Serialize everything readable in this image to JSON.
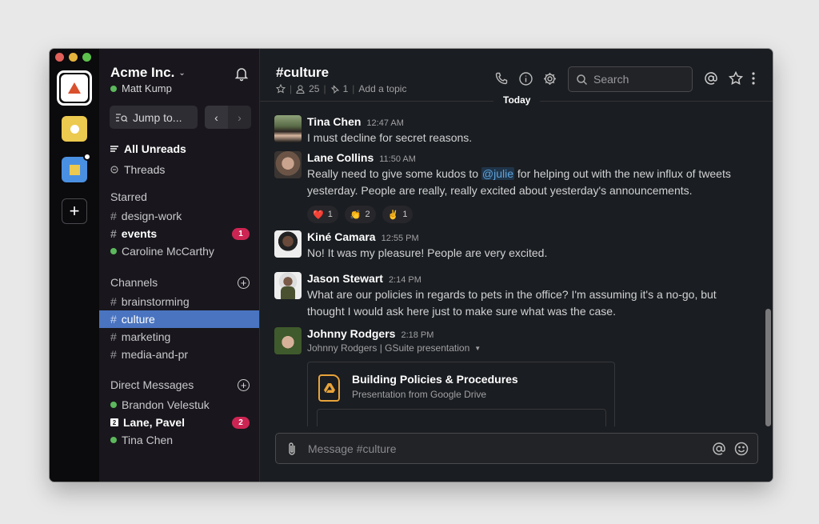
{
  "window": {
    "traffic_lights": {
      "close": "#e0605a",
      "minimize": "#e5b43c",
      "maximize": "#5cc24c"
    }
  },
  "rail": {
    "workspaces": [
      {
        "name": "Acme Inc.",
        "color": "#ffffff",
        "accent": "#d9502d",
        "active": true
      },
      {
        "name": "Yellow workspace",
        "color": "#ecc94f"
      },
      {
        "name": "Blue workspace",
        "color": "#4a90e2",
        "has_notification": true
      }
    ],
    "add_label": "+"
  },
  "sidebar": {
    "team_name": "Acme Inc.",
    "user_name": "Matt Kump",
    "jump_to": "Jump to...",
    "nav": [
      {
        "label": "All Unreads",
        "icon": "list-icon",
        "bold": true
      },
      {
        "label": "Threads",
        "icon": "threads-icon"
      }
    ],
    "starred": {
      "title": "Starred",
      "items": [
        {
          "label": "design-work",
          "type": "channel"
        },
        {
          "label": "events",
          "type": "channel",
          "bold": true,
          "badge": "1"
        },
        {
          "label": "Caroline McCarthy",
          "type": "dm",
          "online": true
        }
      ]
    },
    "channels": {
      "title": "Channels",
      "items": [
        {
          "label": "brainstorming"
        },
        {
          "label": "culture",
          "active": true
        },
        {
          "label": "marketing"
        },
        {
          "label": "media-and-pr"
        }
      ]
    },
    "direct_messages": {
      "title": "Direct Messages",
      "items": [
        {
          "label": "Brandon Velestuk",
          "online": true
        },
        {
          "label": "Lane, Pavel",
          "bold": true,
          "group_count": "2",
          "badge": "2"
        },
        {
          "label": "Tina Chen",
          "online": true
        }
      ]
    }
  },
  "header": {
    "channel": "#culture",
    "members": "25",
    "pinned": "1",
    "topic": "Add a topic",
    "separator": "|",
    "search_placeholder": "Search",
    "date_divider": "Today"
  },
  "messages": [
    {
      "author": "Tina Chen",
      "time": "12:47 AM",
      "text": "I must decline for secret reasons."
    },
    {
      "author": "Lane Collins",
      "time": "11:50 AM",
      "text_before": "Really need to give some kudos to ",
      "mention": "@julie",
      "text_after": " for helping out with the new influx of tweets yesterday. People are really, really excited about yesterday's announcements.",
      "reactions": [
        {
          "emoji": "❤️",
          "count": "1"
        },
        {
          "emoji": "👏",
          "count": "2"
        },
        {
          "emoji": "✌️",
          "count": "1"
        }
      ]
    },
    {
      "author": "Kiné Camara",
      "time": "12:55 PM",
      "text": "No! It was my pleasure! People are very excited."
    },
    {
      "author": "Jason Stewart",
      "time": "2:14 PM",
      "text": "What are our policies in regards to pets in the office? I'm assuming it's a no-go, but thought I would ask here just to make sure what was the case."
    },
    {
      "author": "Johnny Rodgers",
      "time": "2:18 PM",
      "attachment_line": "Johnny Rodgers | GSuite presentation",
      "attachment": {
        "title": "Building Policies & Procedures",
        "subtitle": "Presentation from Google Drive"
      }
    }
  ],
  "composer": {
    "placeholder": "Message #culture"
  }
}
